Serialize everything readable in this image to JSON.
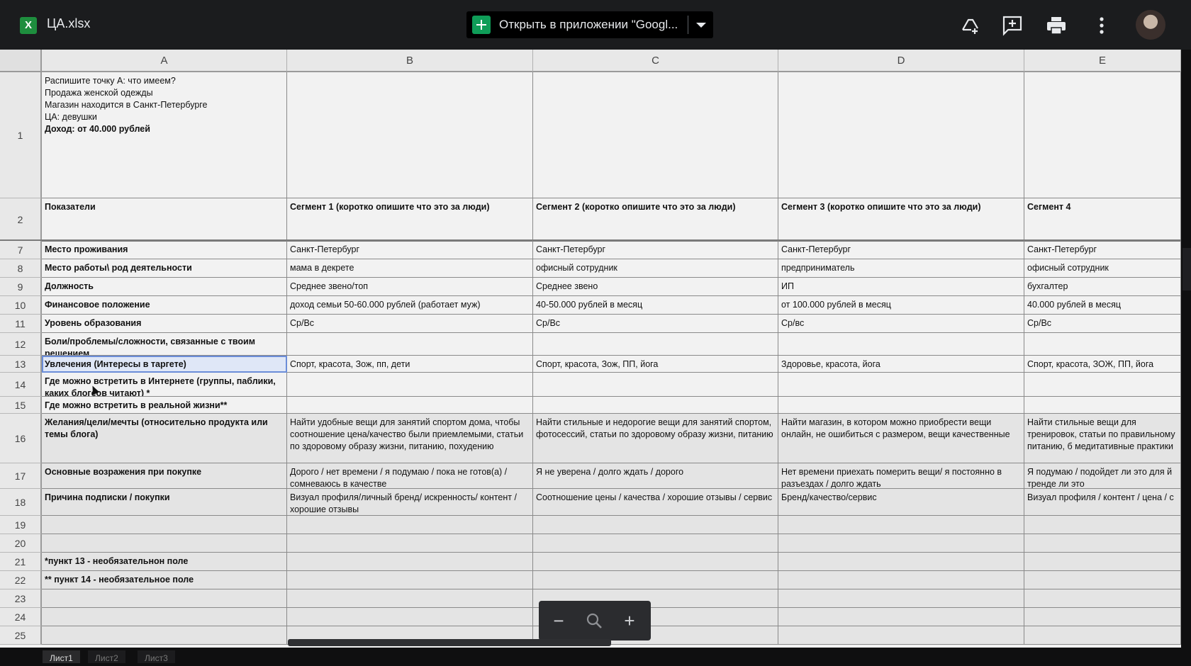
{
  "app": {
    "file_badge": "X",
    "filename": "ЦА.xlsx",
    "open_button": "Открыть в приложении \"Googl...",
    "icons": [
      "drive-add-icon",
      "add-comment-icon",
      "print-icon",
      "more-vert-icon"
    ]
  },
  "columns": [
    "A",
    "B",
    "C",
    "D",
    "E"
  ],
  "rows": [
    {
      "num": "1",
      "cells": [
        "Распишите точку А: что имеем?\nПродажа женской одежды\nМагазин находится в Санкт-Петербурге\nЦА: девушки",
        "",
        "",
        "",
        ""
      ],
      "extra": "Доход: от 40.000 рублей"
    },
    {
      "num": "2",
      "cells": [
        "Показатели",
        "Сегмент 1 (коротко опишите что это за люди)",
        "Сегмент 2  (коротко опишите что это за люди)",
        "Сегмент 3 (коротко опишите что это за люди)",
        "Сегмент 4"
      ]
    },
    {
      "num": "7",
      "cells": [
        "Место проживания",
        "Санкт-Петербург",
        "Санкт-Петербург",
        "Санкт-Петербург",
        "Санкт-Петербург"
      ]
    },
    {
      "num": "8",
      "cells": [
        "Место работы\\ род деятельности",
        "мама в декрете",
        "офисный сотрудник",
        "предприниматель",
        "офисный сотрудник"
      ]
    },
    {
      "num": "9",
      "cells": [
        "Должность",
        "Среднее звено/топ",
        "Среднее звено",
        "ИП",
        "бухгалтер"
      ]
    },
    {
      "num": "10",
      "cells": [
        "Финансовое положение",
        "доход семьи 50-60.000 рублей (работает муж)",
        "40-50.000 рублей в месяц",
        "от 100.000 рублей в месяц",
        "40.000 рублей в месяц"
      ]
    },
    {
      "num": "11",
      "cells": [
        "Уровень образования",
        "Ср/Вс",
        "Ср/Вс",
        "Ср/вс",
        "Ср/Вс"
      ]
    },
    {
      "num": "12",
      "cells": [
        "Боли/проблемы/сложности, связанные с твоим решением",
        "",
        "",
        "",
        ""
      ]
    },
    {
      "num": "13",
      "cells": [
        "Увлечения (Интересы в таргете)",
        "Спорт, красота, Зож, пп, дети",
        "Спорт, красота, Зож, ПП, йога",
        "Здоровье, красота, йога",
        "Спорт, красота, ЗОЖ, ПП, йога"
      ]
    },
    {
      "num": "14",
      "cells": [
        "Где можно встретить в Интернете (группы, паблики, каких блогеов читают) *",
        "",
        "",
        "",
        ""
      ]
    },
    {
      "num": "15",
      "cells": [
        "Где можно встретить в реальной жизни**",
        "",
        "",
        "",
        ""
      ]
    },
    {
      "num": "16",
      "cells": [
        "Желания/цели/мечты (относительно продукта или темы блога)",
        "Найти удобные вещи для занятий спортом дома, чтобы соотношение цена/качество были приемлемыми, статьи по здоровому образу жизни, питанию, похудению",
        "Найти стильные и недорогие вещи для занятий спортом, фотосессий, статьи по здоровому образу жизни, питанию",
        "Найти магазин, в котором можно приобрести вещи онлайн, не ошибиться с размером, вещи качественные",
        "Найти стильные вещи для тренировок, статьи по правильному питанию, б медитативные практики"
      ]
    },
    {
      "num": "17",
      "cells": [
        "Основные возражения при покупке",
        "Дорого / нет времени / я подумаю / пока не готов(а) / сомневаюсь в качестве",
        "Я не уверена / долго ждать / дорого",
        "Нет времени приехать померить вещи/ я постоянно в разъездах / долго ждать",
        "Я подумаю / подойдет ли это для й трендe ли это"
      ]
    },
    {
      "num": "18",
      "cells": [
        "Причина подписки / покупки",
        "Визуал профиля/личный бренд/ искренность/ контент / хорошие отзывы",
        "Соотношение цены / качества / хорошие отзывы / сервис",
        "Бренд/качество/сервис",
        "Визуал профиля / контент / цена / с"
      ]
    },
    {
      "num": "19",
      "cells": [
        "",
        "",
        "",
        "",
        ""
      ]
    },
    {
      "num": "20",
      "cells": [
        "",
        "",
        "",
        "",
        ""
      ]
    },
    {
      "num": "21",
      "cells": [
        "*пункт 13 - необязательнон поле",
        "",
        "",
        "",
        ""
      ]
    },
    {
      "num": "22",
      "cells": [
        "** пункт 14 - необязательное поле",
        "",
        "",
        "",
        ""
      ]
    },
    {
      "num": "23",
      "cells": [
        "",
        "",
        "",
        "",
        ""
      ]
    },
    {
      "num": "24",
      "cells": [
        "",
        "",
        "",
        "",
        ""
      ]
    },
    {
      "num": "25",
      "cells": [
        "",
        "",
        "",
        "",
        ""
      ]
    }
  ],
  "zoom": {
    "minus": "−",
    "plus": "+"
  },
  "tabs": [
    "Лист1",
    "Лист2",
    "Лист3"
  ]
}
